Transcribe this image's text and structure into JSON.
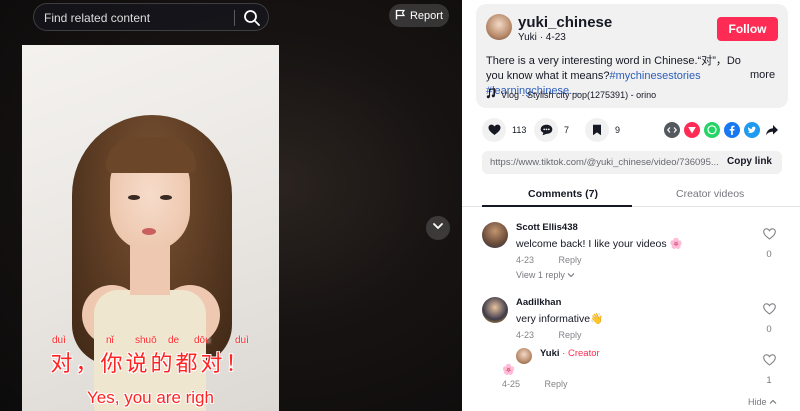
{
  "search": {
    "placeholder": "Find related content"
  },
  "player": {
    "report_label": "Report",
    "pinyin": [
      "duì",
      "nǐ",
      "shuō",
      "de",
      "dōu",
      "duì"
    ],
    "subtitle_cn": "对，你说的都对！",
    "subtitle_en": "Yes, you are righ"
  },
  "author": {
    "username": "yuki_chinese",
    "nickname": "Yuki",
    "date": "4-23",
    "follow_label": "Follow"
  },
  "description": {
    "text": "There is a very interesting word in Chinese.“对”，Do you know what it means?",
    "tags": "#mychinesestories #learningchinese...",
    "more_label": "more"
  },
  "music": {
    "label": "Vlog · Stylish city pop(1275391) - orino"
  },
  "actions": {
    "likes": "113",
    "comments": "7",
    "saves": "9"
  },
  "share_icons": [
    {
      "name": "embed-icon",
      "color": "#54595f"
    },
    {
      "name": "send-icon",
      "color": "#fe2c55"
    },
    {
      "name": "whatsapp-icon",
      "color": "#25d366"
    },
    {
      "name": "facebook-icon",
      "color": "#1877f2"
    },
    {
      "name": "twitter-icon",
      "color": "#1d9bf0"
    },
    {
      "name": "share-arrow-icon",
      "color": "#161823"
    }
  ],
  "link": {
    "url": "https://www.tiktok.com/@yuki_chinese/video/736095...",
    "copy_label": "Copy link"
  },
  "tabs": {
    "comments": "Comments (7)",
    "creator_videos": "Creator videos"
  },
  "comments": [
    {
      "name": "Scott Ellis438",
      "text": "welcome back! I like your videos 🌸",
      "date": "4-23",
      "reply_label": "Reply",
      "likes": "0",
      "view_replies": "View 1 reply"
    },
    {
      "name": "Aadilkhan",
      "text": "very informative👋",
      "date": "4-23",
      "reply_label": "Reply",
      "likes": "0"
    },
    {
      "name": "Yuki",
      "creator_label": " · Creator",
      "text": "🌸",
      "date": "4-25",
      "reply_label": "Reply",
      "likes": "1"
    }
  ],
  "hide_label": "Hide",
  "colors": {
    "accent": "#fe2c55",
    "hashtag": "#2b5db9"
  }
}
